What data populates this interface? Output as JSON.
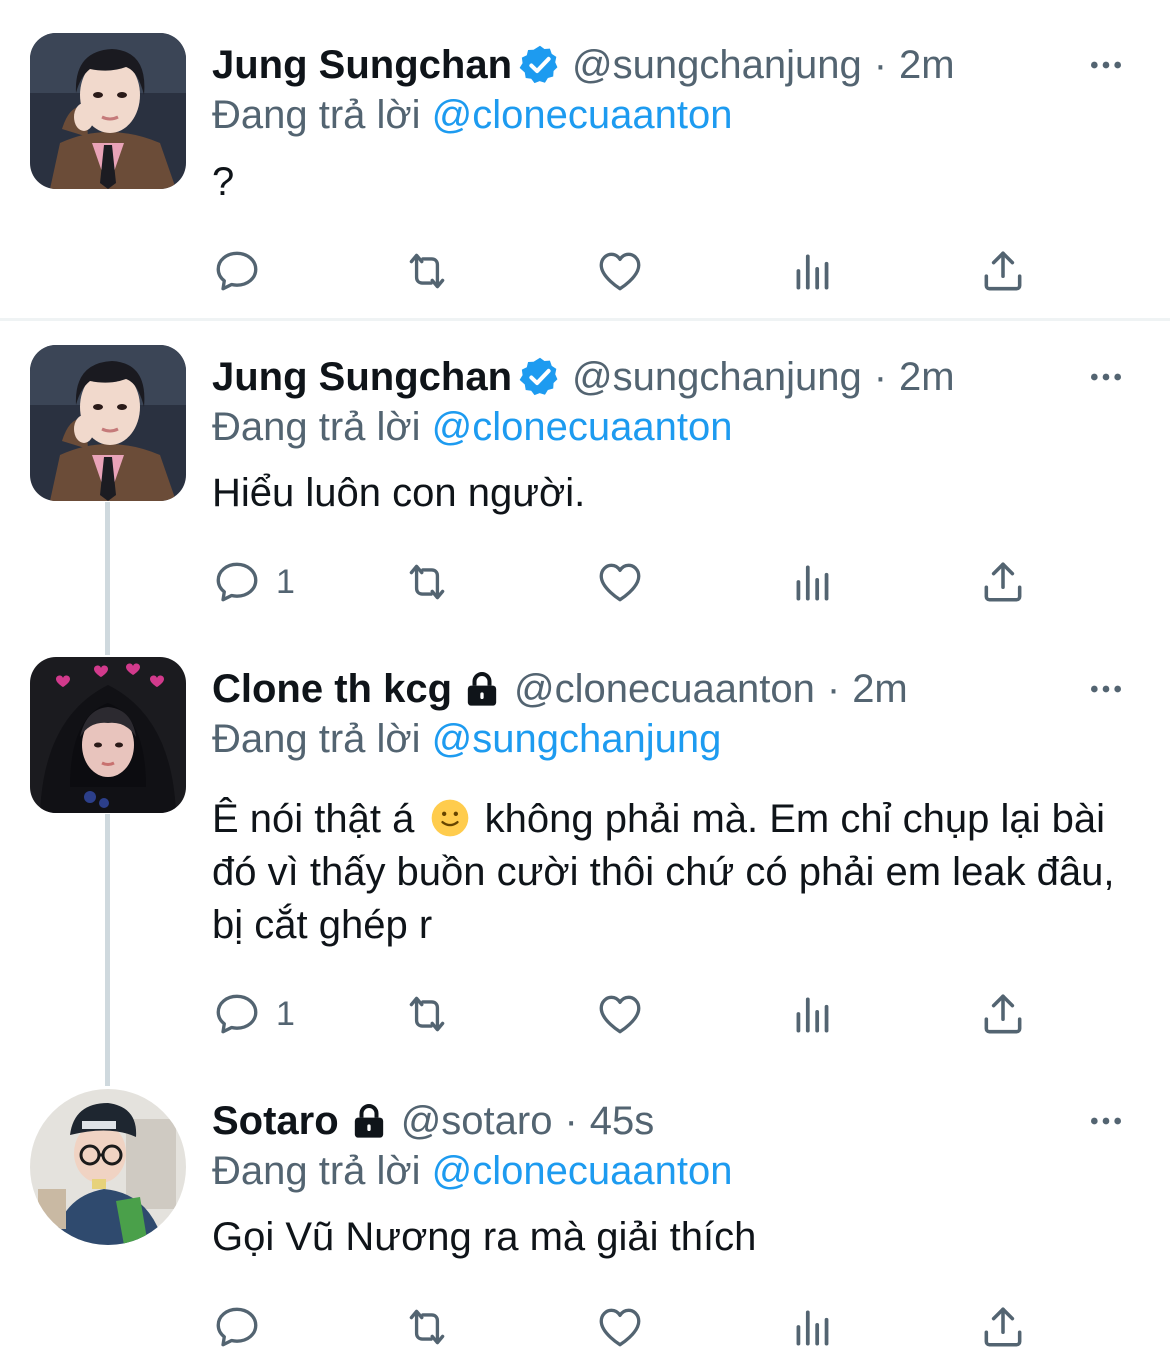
{
  "tweets": [
    {
      "author": {
        "name": "Jung Sungchan",
        "handle": "@sungchanjung",
        "verified": true,
        "locked": false
      },
      "time": "2m",
      "replying_prefix": "Đang trả lời",
      "replying_to": "@clonecuaanton",
      "text": "?",
      "reply_count": ""
    },
    {
      "author": {
        "name": "Jung Sungchan",
        "handle": "@sungchanjung",
        "verified": true,
        "locked": false
      },
      "time": "2m",
      "replying_prefix": "Đang trả lời",
      "replying_to": "@clonecuaanton",
      "text": "Hiểu luôn con người.",
      "reply_count": "1"
    },
    {
      "author": {
        "name": "Clone th kcg",
        "handle": "@clonecuaanton",
        "verified": false,
        "locked": true
      },
      "time": "2m",
      "replying_prefix": "Đang trả lời",
      "replying_to": "@sungchanjung",
      "text_part1": "Ê nói thật á",
      "text_emoji": "slightly-smiling-face",
      "text_part2": " không phải mà. Em chỉ chụp lại bài đó vì thấy buồn cười thôi chứ có phải em leak đâu, bị cắt ghép r",
      "reply_count": "1"
    },
    {
      "author": {
        "name": "Sotaro",
        "handle": "@sotaro",
        "verified": false,
        "locked": true
      },
      "time": "45s",
      "replying_prefix": "Đang trả lời",
      "replying_to": "@clonecuaanton",
      "text": "Gọi Vũ Nương ra mà giải thích",
      "reply_count": ""
    }
  ],
  "separator": "·",
  "colors": {
    "accent": "#1d9bf0",
    "secondary_text": "#536471",
    "primary_text": "#0f1419",
    "thread_line": "#cfd9de"
  },
  "icons": [
    "reply-icon",
    "retweet-icon",
    "like-icon",
    "views-icon",
    "share-icon",
    "more-icon",
    "verified-badge-icon",
    "lock-icon"
  ]
}
